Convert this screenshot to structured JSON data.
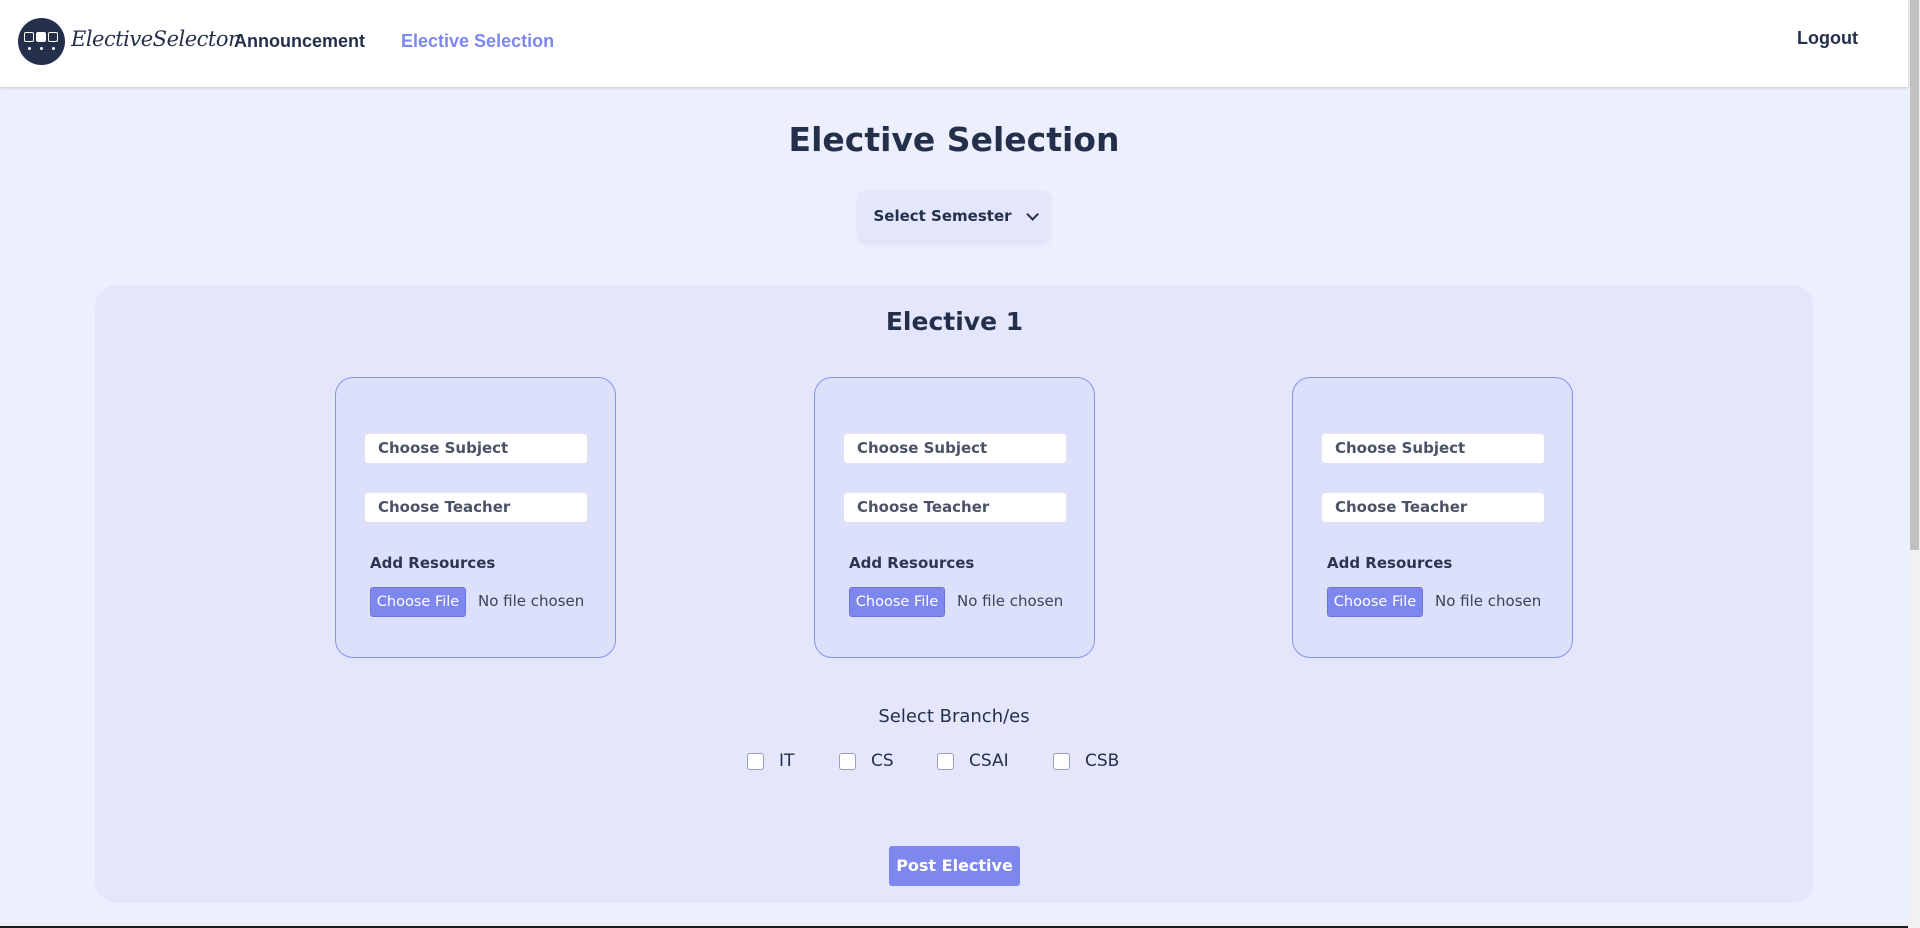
{
  "navbar": {
    "logo_text": "ElectiveSelector",
    "links": [
      {
        "label": "Announcement",
        "active": false
      },
      {
        "label": "Elective Selection",
        "active": true
      }
    ],
    "logout_label": "Logout"
  },
  "page": {
    "title": "Elective Selection",
    "semester_dropdown": "Select Semester"
  },
  "elective": {
    "title": "Elective 1",
    "cards": [
      {
        "subject_placeholder": "Choose Subject",
        "teacher_placeholder": "Choose Teacher",
        "resources_label": "Add Resources",
        "file_button": "Choose File",
        "file_status": "No file chosen"
      },
      {
        "subject_placeholder": "Choose Subject",
        "teacher_placeholder": "Choose Teacher",
        "resources_label": "Add Resources",
        "file_button": "Choose File",
        "file_status": "No file chosen"
      },
      {
        "subject_placeholder": "Choose Subject",
        "teacher_placeholder": "Choose Teacher",
        "resources_label": "Add Resources",
        "file_button": "Choose File",
        "file_status": "No file chosen"
      }
    ],
    "branch_title": "Select Branch/es",
    "branches": [
      {
        "label": "IT",
        "checked": false
      },
      {
        "label": "CS",
        "checked": false
      },
      {
        "label": "CSAI",
        "checked": false
      },
      {
        "label": "CSB",
        "checked": false
      }
    ],
    "post_button": "Post Elective"
  },
  "colors": {
    "accent": "#7d87ee",
    "primary_dark": "#24304b",
    "background": "#eceffd",
    "panel": "#e4e7fb"
  }
}
